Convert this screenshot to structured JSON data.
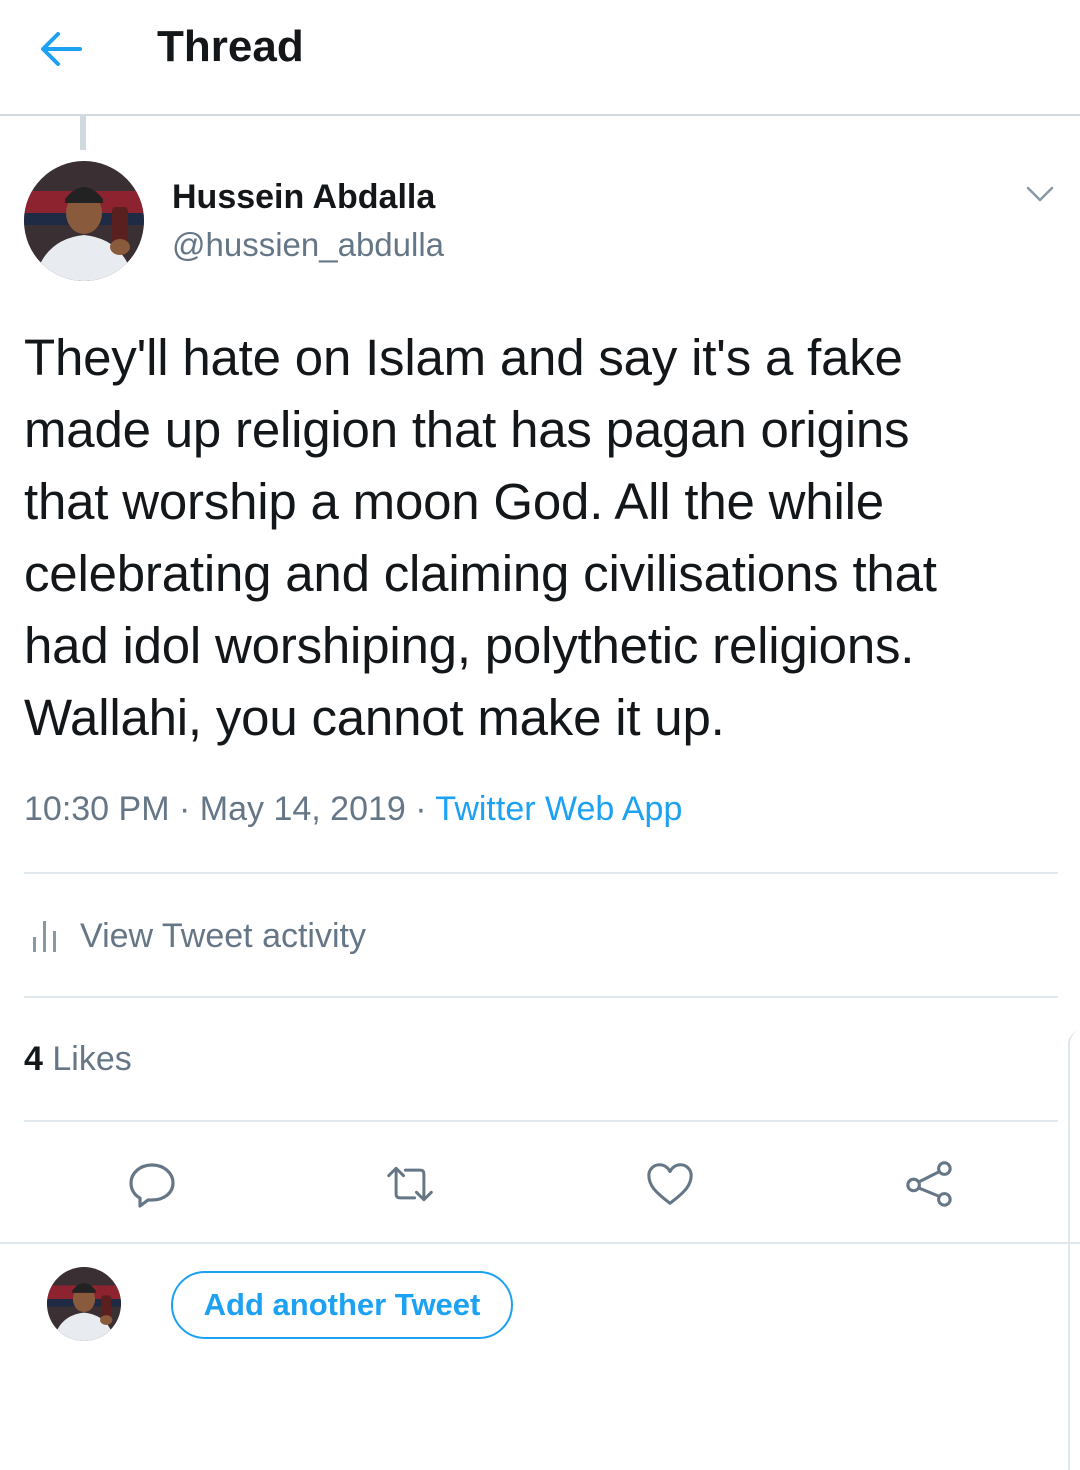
{
  "header": {
    "title": "Thread",
    "back_icon": "arrow-left-icon"
  },
  "tweet": {
    "author_name": "Hussein Abdalla",
    "author_handle": "@hussien_abdulla",
    "text": "They'll hate on Islam and say it's a fake\nmade up religion that has pagan origins\nthat worship a moon God. All the while\ncelebrating and claiming civilisations that\nhad idol worshiping, polythetic religions.\nWallahi, you cannot make it up.",
    "time": "10:30 PM",
    "date": "May 14, 2019",
    "separator": "·",
    "source": "Twitter Web App"
  },
  "activity": {
    "label": "View Tweet activity",
    "icon": "bar-chart-icon"
  },
  "likes": {
    "count": "4",
    "label": "Likes"
  },
  "actions": [
    "reply-icon",
    "retweet-icon",
    "like-icon",
    "share-icon"
  ],
  "compose": {
    "button_label": "Add another Tweet"
  },
  "colors": {
    "accent": "#1da1f2",
    "text": "#14171a",
    "secondary": "#657786",
    "border": "#e1e8ed"
  }
}
